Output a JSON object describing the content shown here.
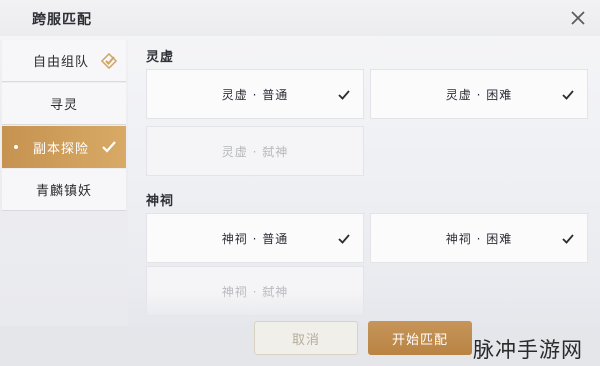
{
  "dialog": {
    "title": "跨服匹配"
  },
  "sidebar": {
    "items": [
      {
        "label": "自由组队",
        "state": "checked"
      },
      {
        "label": "寻灵",
        "state": "normal"
      },
      {
        "label": "副本探险",
        "state": "active"
      },
      {
        "label": "青麟镇妖",
        "state": "normal"
      }
    ]
  },
  "sections": [
    {
      "title": "灵虚",
      "options": [
        {
          "label": "灵虚 · 普通",
          "checked": true,
          "enabled": true
        },
        {
          "label": "灵虚 · 困难",
          "checked": true,
          "enabled": true
        },
        {
          "label": "灵虚 · 弑神",
          "checked": false,
          "enabled": false
        }
      ]
    },
    {
      "title": "神祠",
      "options": [
        {
          "label": "神祠 · 普通",
          "checked": true,
          "enabled": true
        },
        {
          "label": "神祠 · 困难",
          "checked": true,
          "enabled": true
        },
        {
          "label": "神祠 · 弑神",
          "checked": false,
          "enabled": false
        }
      ]
    }
  ],
  "footer": {
    "cancel_label": "取消",
    "start_label": "开始匹配"
  },
  "watermark": "脉冲手游网",
  "colors": {
    "accent": "#c9975a",
    "text": "#2d2e34",
    "disabled_text": "#b7b8bd"
  }
}
